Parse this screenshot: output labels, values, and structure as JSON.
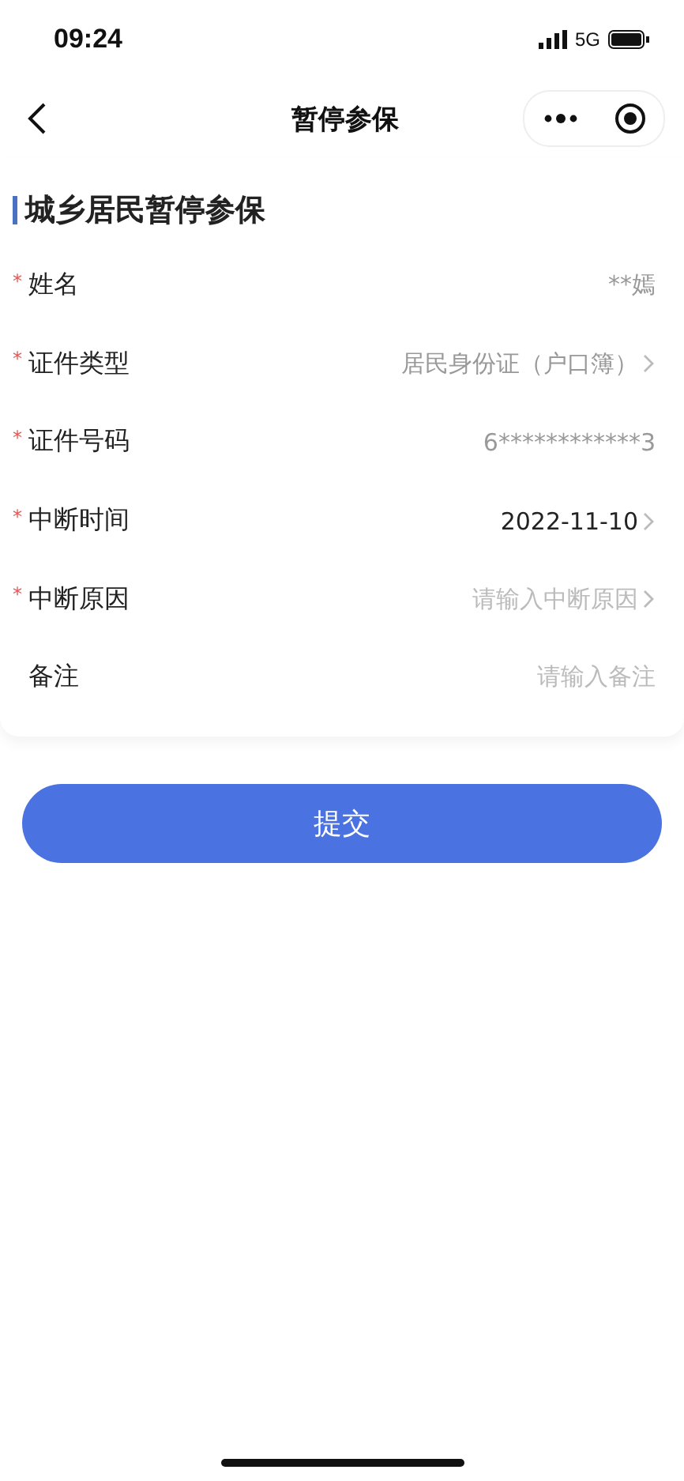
{
  "status_bar": {
    "time": "09:24",
    "network": "5G"
  },
  "nav": {
    "title": "暂停参保"
  },
  "section": {
    "title": "城乡居民暂停参保"
  },
  "fields": [
    {
      "required_mark": "*",
      "label": "姓名",
      "value": "**嫣",
      "disabled": true,
      "arrow": false
    },
    {
      "required_mark": "*",
      "label": "证件类型",
      "value": "居民身份证（户口簿）",
      "disabled": true,
      "arrow": true
    },
    {
      "required_mark": "*",
      "label": "证件号码",
      "value": "6************3",
      "disabled": true,
      "arrow": false
    },
    {
      "required_mark": "*",
      "label": "中断时间",
      "value": "2022-11-10",
      "disabled": false,
      "arrow": true
    },
    {
      "required_mark": "*",
      "label": "中断原因",
      "placeholder": "请输入中断原因",
      "arrow": true
    },
    {
      "label": "备注",
      "placeholder": "请输入备注",
      "arrow": false
    }
  ],
  "submit": {
    "label": "提交"
  }
}
